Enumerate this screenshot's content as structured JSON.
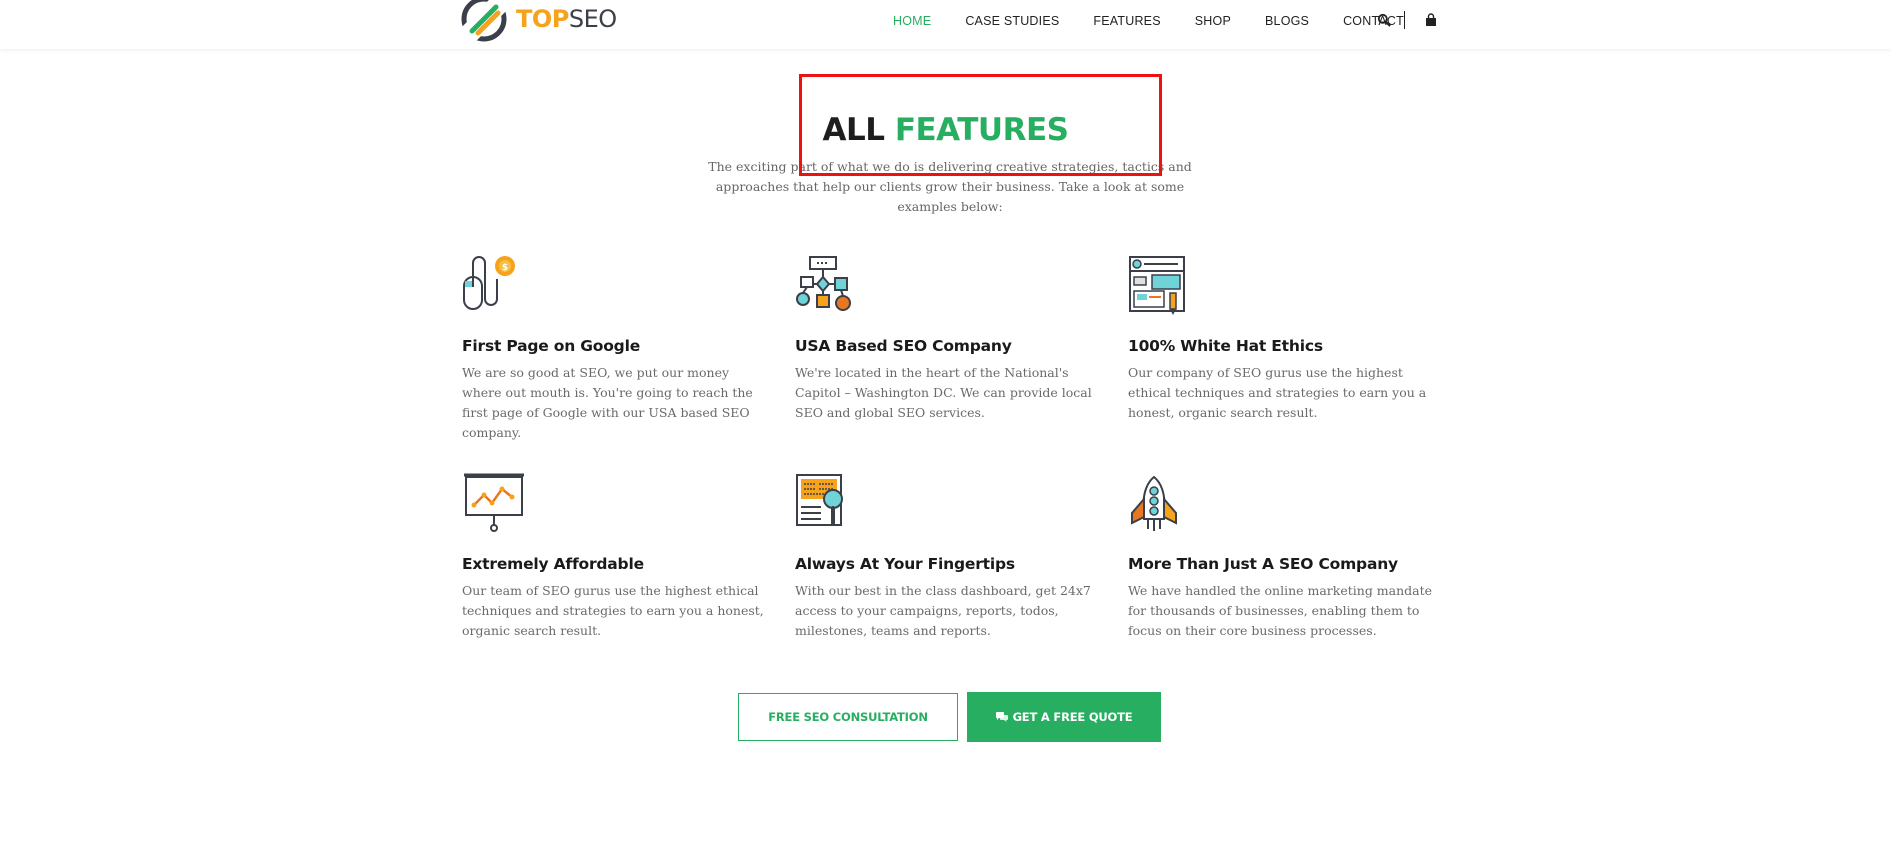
{
  "header": {
    "logo": {
      "text_top": "TOP",
      "text_seo": "SEO"
    },
    "nav": [
      {
        "label": "HOME",
        "active": true
      },
      {
        "label": "CASE STUDIES",
        "active": false
      },
      {
        "label": "FEATURES",
        "active": false
      },
      {
        "label": "SHOP",
        "active": false
      },
      {
        "label": "BLOGS",
        "active": false
      },
      {
        "label": "CONTACT",
        "active": false
      }
    ],
    "icons": [
      "search-icon",
      "shopping-bag-icon"
    ]
  },
  "hero": {
    "title_part1": "ALL",
    "title_part2": "FEATURES",
    "subtitle": "The exciting part of what we do is delivering creative strategies, tactics and approaches that help our clients grow their business. Take a look at some examples below:"
  },
  "features": [
    {
      "icon": "mouse-coin-icon",
      "title": "First Page on Google",
      "description": "We are so good at SEO, we put our money where out mouth is. You're going to reach the first page of Google with our USA based SEO company."
    },
    {
      "icon": "flowchart-icon",
      "title": "USA Based SEO Company",
      "description": "We're located in the heart of the National's Capitol – Washington DC. We can provide local SEO and global SEO services."
    },
    {
      "icon": "web-layout-icon",
      "title": "100% White Hat Ethics",
      "description": "Our company of SEO gurus use the highest ethical techniques and strategies to earn you a honest, organic search result."
    },
    {
      "icon": "presentation-chart-icon",
      "title": "Extremely Affordable",
      "description": "Our team of SEO gurus use the highest ethical techniques and strategies to earn you a honest, organic search result."
    },
    {
      "icon": "code-search-icon",
      "title": "Always At Your Fingertips",
      "description": "With our best in the class dashboard, get 24x7 access to your campaigns, reports, todos, milestones, teams and reports."
    },
    {
      "icon": "rocket-icon",
      "title": "More Than Just A SEO Company",
      "description": "We have handled the online marketing mandate for thousands of businesses, enabling them to focus on their core business processes."
    }
  ],
  "cta": {
    "consult_label": "FREE SEO CONSULTATION",
    "quote_label": "GET A FREE QUOTE"
  },
  "colors": {
    "brand_green": "#27ae60",
    "brand_orange": "#f7a21b",
    "highlight_red": "#ee1111"
  }
}
